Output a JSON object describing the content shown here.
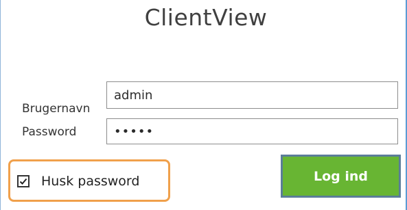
{
  "app": {
    "title": "ClientView"
  },
  "login_form": {
    "username_label": "Brugernavn",
    "username_value": "admin",
    "password_label": "Password",
    "password_value": "•••••",
    "remember_label": "Husk password",
    "remember_checked": true,
    "login_button_label": "Log ind"
  },
  "colors": {
    "button_green": "#68b533",
    "highlight_orange": "#f0a04b",
    "frame_blue": "#5b9bd5"
  }
}
